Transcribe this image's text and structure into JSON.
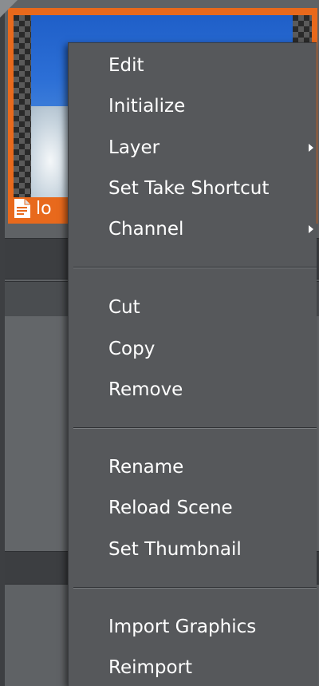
{
  "thumbnail": {
    "label": "lo",
    "icon": "file-icon",
    "accent_color": "#e8691c"
  },
  "context_menu": {
    "groups": [
      {
        "items": [
          {
            "label": "Edit",
            "has_submenu": false
          },
          {
            "label": "Initialize",
            "has_submenu": false
          },
          {
            "label": "Layer",
            "has_submenu": true
          },
          {
            "label": "Set Take Shortcut",
            "has_submenu": false
          },
          {
            "label": "Channel",
            "has_submenu": true
          }
        ]
      },
      {
        "items": [
          {
            "label": "Cut",
            "has_submenu": false
          },
          {
            "label": "Copy",
            "has_submenu": false
          },
          {
            "label": "Remove",
            "has_submenu": false
          }
        ]
      },
      {
        "items": [
          {
            "label": "Rename",
            "has_submenu": false
          },
          {
            "label": "Reload Scene",
            "has_submenu": false
          },
          {
            "label": "Set Thumbnail",
            "has_submenu": false
          }
        ]
      },
      {
        "items": [
          {
            "label": "Import Graphics",
            "has_submenu": false
          },
          {
            "label": "Reimport",
            "has_submenu": false
          }
        ]
      }
    ]
  }
}
